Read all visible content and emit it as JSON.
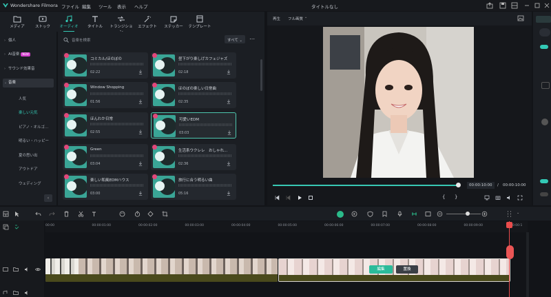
{
  "titlebar": {
    "app_name": "Wondershare Filmora",
    "menu": [
      "ファイル",
      "編集",
      "ツール",
      "表示",
      "ヘルプ"
    ],
    "window_title": "タイトルなし"
  },
  "tabs": [
    {
      "label": "メディア",
      "icon": "folder-icon"
    },
    {
      "label": "ストック",
      "icon": "stock-icon"
    },
    {
      "label": "オーディオ",
      "icon": "music-note-icon"
    },
    {
      "label": "タイトル",
      "icon": "text-icon"
    },
    {
      "label": "トランジション",
      "icon": "transition-icon"
    },
    {
      "label": "エフェクト",
      "icon": "effect-icon"
    },
    {
      "label": "ステッカー",
      "icon": "sticker-icon"
    },
    {
      "label": "テンプレート",
      "icon": "template-icon"
    }
  ],
  "sidenav": {
    "items": [
      {
        "label": "個人"
      },
      {
        "label": "AI音楽",
        "badge": "NEW"
      },
      {
        "label": "サウンド効果音"
      },
      {
        "label": "音楽"
      }
    ],
    "subitems": [
      "人気",
      "楽しい元気",
      "ピアノ・オルゴ...",
      "明るい・ハッピー",
      "夏の思い出",
      "アウトドア",
      "ウェディング"
    ]
  },
  "search": {
    "placeholder": "音楽を検索",
    "sort": "すべて"
  },
  "tracks": [
    {
      "title": "コミカル/ほのぼの",
      "duration": "02:22"
    },
    {
      "title": "昼下がり楽しげカフェジャズ",
      "duration": "02:18"
    },
    {
      "title": "Window Shopping",
      "duration": "01:56"
    },
    {
      "title": "ほのぼの楽しい日常曲",
      "duration": "02:35"
    },
    {
      "title": "ほんわか日常",
      "duration": "02:55"
    },
    {
      "title": "可愛いEDM",
      "duration": "03:03"
    },
    {
      "title": "Green",
      "duration": "03:04"
    },
    {
      "title": "生活系ウクレレ　おしゃれ...",
      "duration": "02:36"
    },
    {
      "title": "楽しい和風EDMハウス",
      "duration": "03:00"
    },
    {
      "title": "旅行に合う明るい曲",
      "duration": "05:16"
    }
  ],
  "preview": {
    "label": "再生",
    "quality": "フル画質",
    "current_time": "00:00:10:00",
    "total_time": "00:00:10:00",
    "progress": 1.0
  },
  "timeline": {
    "ruler": [
      "00:00",
      "00:00:01:00",
      "00:00:02:00",
      "00:00:03:00",
      "00:00:04:00",
      "00:00:05:00",
      "00:00:06:00",
      "00:00:07:00",
      "00:00:08:00",
      "00:00:09:00",
      "00:00:1"
    ],
    "clip_buttons": [
      "編集",
      "置換"
    ]
  },
  "colors": {
    "accent": "#33c9b5",
    "playhead": "#ea4c4c"
  }
}
